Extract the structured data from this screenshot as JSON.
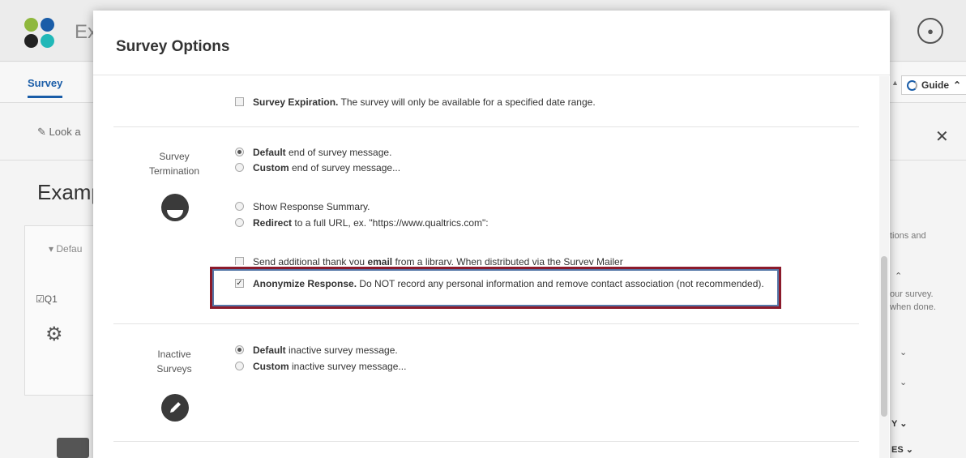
{
  "app": {
    "project_title": "Ex",
    "tab_survey": "Survey",
    "look_label": "Look a",
    "survey_title": "Examp",
    "block_default": "Defau",
    "question_label": "Q1",
    "guide_label": "Guide",
    "side_texts": [
      "tions and",
      "our survey.",
      "when done.",
      "Y",
      "ES"
    ]
  },
  "modal": {
    "title": "Survey Options",
    "survey_expiration": {
      "bold": "Survey Expiration.",
      "text": " The survey will only be available for a specified date range.",
      "checked": false
    },
    "termination": {
      "label_line1": "Survey",
      "label_line2": "Termination",
      "icon": "half-circle-icon",
      "default_bold": "Default",
      "default_text": " end of survey message.",
      "custom_bold": "Custom",
      "custom_text": " end of survey message...",
      "response_summary": "Show Response Summary.",
      "redirect_bold": "Redirect",
      "redirect_text": " to a full URL, ex. \"https://www.qualtrics.com\":",
      "email_text_a": "Send additional thank you ",
      "email_bold": "email",
      "email_text_b": " from a library.   When distributed via the Survey Mailer",
      "anonymize_bold": "Anonymize Response.",
      "anonymize_text": " Do NOT record any personal information and remove contact association (not recommended).",
      "anonymize_checked": true
    },
    "inactive": {
      "label_line1": "Inactive",
      "label_line2": "Surveys",
      "icon": "pencil-icon",
      "default_bold": "Default",
      "default_text": " inactive survey message.",
      "custom_bold": "Custom",
      "custom_text": " inactive survey message..."
    }
  },
  "colors": {
    "highlight_outer": "#8b1a2b",
    "highlight_inner": "#5577a8",
    "brand_blue": "#1a5da8"
  }
}
